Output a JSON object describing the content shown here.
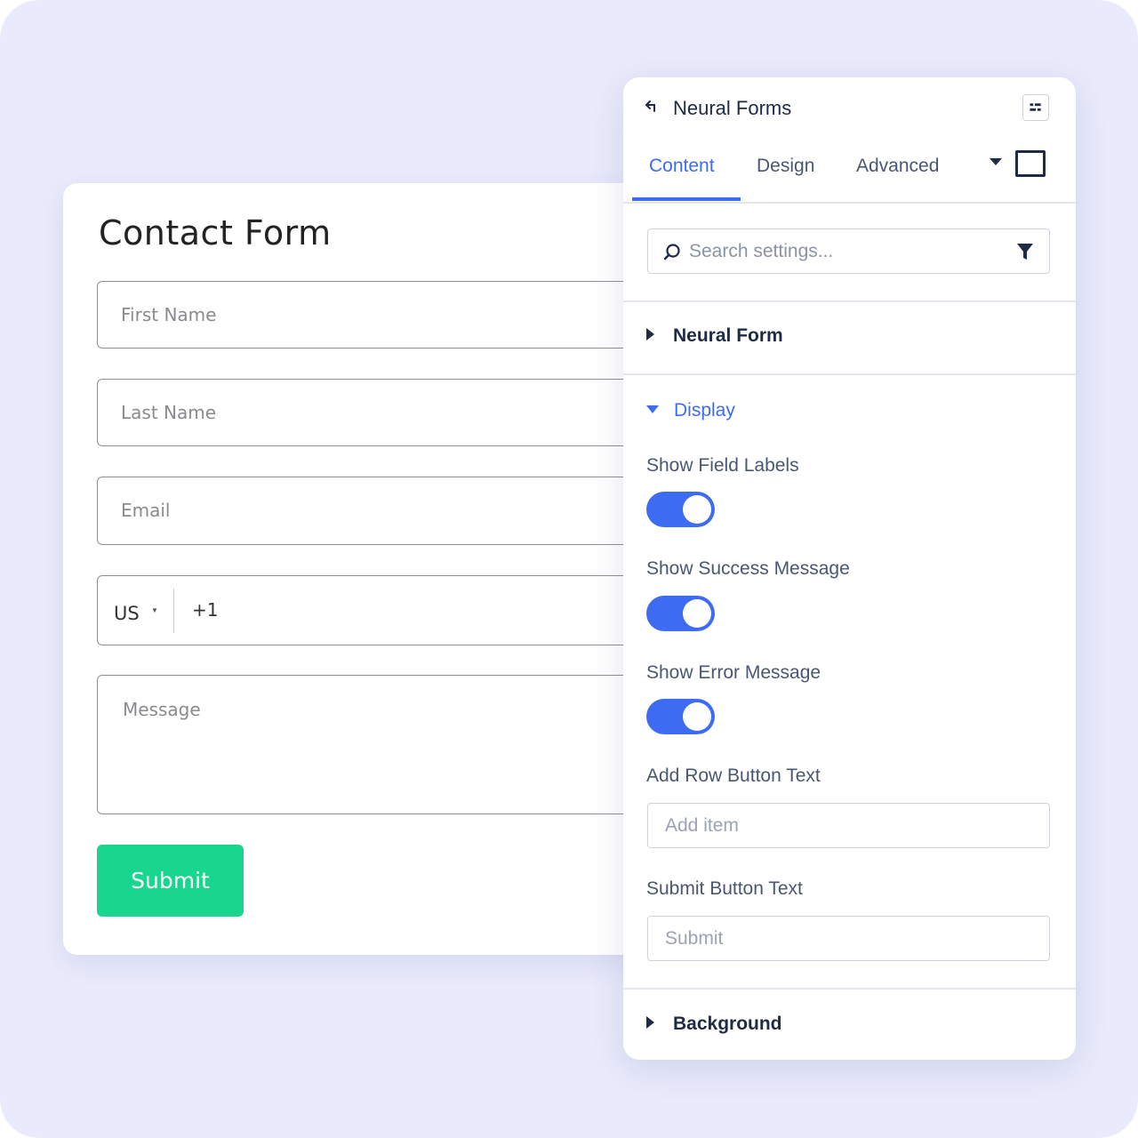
{
  "contact_form": {
    "title": "Contact Form",
    "first_name_placeholder": "First Name",
    "last_name_placeholder": "Last Name",
    "email_placeholder": "Email",
    "phone_country": "US",
    "phone_dial_code": "+1",
    "message_placeholder": "Message",
    "submit_label": "Submit",
    "submit_color": "#19d68f"
  },
  "panel": {
    "title": "Neural Forms",
    "tabs": [
      {
        "label": "Content",
        "active": true
      },
      {
        "label": "Design",
        "active": false
      },
      {
        "label": "Advanced",
        "active": false
      }
    ],
    "search_placeholder": "Search settings...",
    "sections": {
      "neural_form": "Neural Form",
      "display": "Display",
      "background": "Background"
    },
    "display_options": {
      "show_field_labels": {
        "label": "Show Field Labels",
        "enabled": true
      },
      "show_success_message": {
        "label": "Show Success Message",
        "enabled": true
      },
      "show_error_message": {
        "label": "Show Error Message",
        "enabled": true
      },
      "add_row_button_text": {
        "label": "Add Row Button Text",
        "placeholder": "Add item"
      },
      "submit_button_text": {
        "label": "Submit Button Text",
        "placeholder": "Submit"
      }
    },
    "accent_color": "#3d6cf2"
  }
}
